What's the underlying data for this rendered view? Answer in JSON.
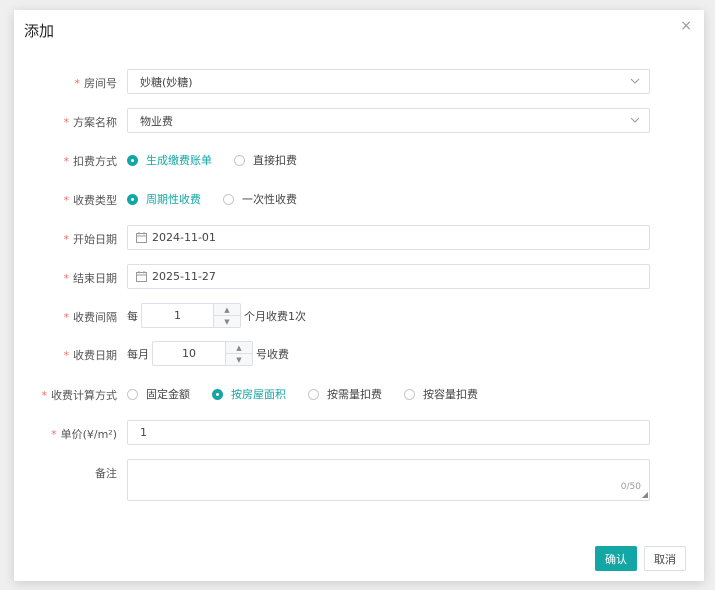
{
  "dialog": {
    "title": "添加",
    "close_glyph": "×"
  },
  "required_mark": "*",
  "fields": {
    "room": {
      "label": "房间号",
      "value": "妙糖(妙糖)"
    },
    "plan": {
      "label": "方案名称",
      "value": "物业费"
    },
    "deduct": {
      "label": "扣费方式",
      "options": [
        "生成缴费账单",
        "直接扣费"
      ],
      "selected": 0
    },
    "charge_type": {
      "label": "收费类型",
      "options": [
        "周期性收费",
        "一次性收费"
      ],
      "selected": 0
    },
    "start_date": {
      "label": "开始日期",
      "value": "2024-11-01"
    },
    "end_date": {
      "label": "结束日期",
      "value": "2025-11-27"
    },
    "interval": {
      "label": "收费间隔",
      "prefix": "每",
      "value": "1",
      "suffix": "个月收费1次"
    },
    "charge_day": {
      "label": "收费日期",
      "prefix": "每月",
      "value": "10",
      "suffix": "号收费"
    },
    "calc": {
      "label": "收费计算方式",
      "options": [
        "固定金额",
        "按房屋面积",
        "按需量扣费",
        "按容量扣费"
      ],
      "selected": 1
    },
    "unit_price": {
      "label": "单价(¥/m²)",
      "value": "1"
    },
    "remark": {
      "label": "备注",
      "value": "",
      "counter": "0/50"
    }
  },
  "buttons": {
    "confirm": "确认",
    "cancel": "取消"
  },
  "colors": {
    "accent": "#14a6a5",
    "required": "#f56c6c"
  }
}
